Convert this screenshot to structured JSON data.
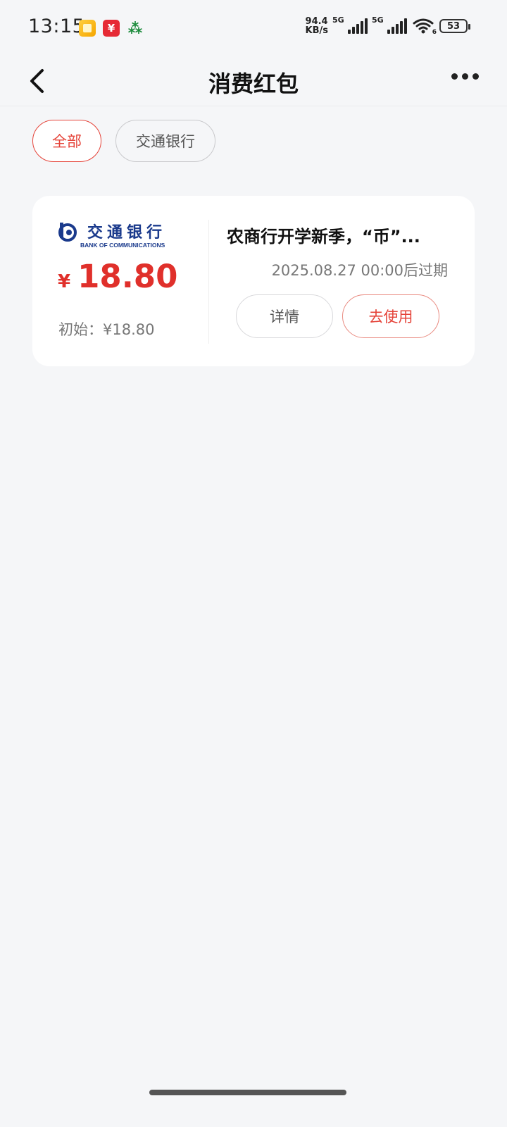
{
  "status_bar": {
    "time": "13:15",
    "net_speed_value": "94.4",
    "net_speed_unit": "KB/s",
    "network_1": "5G",
    "network_2": "5G",
    "wifi_sub": "6",
    "battery": "53"
  },
  "nav": {
    "title": "消费红包"
  },
  "filters": [
    {
      "label": "全部",
      "active": true
    },
    {
      "label": "交通银行",
      "active": false
    }
  ],
  "card": {
    "bank_name_cn": "交通银行",
    "bank_name_en": "BANK OF COMMUNICATIONS",
    "currency": "¥",
    "amount": "18.80",
    "initial_label": "初始：¥18.80",
    "promo_title": "农商行开学新季，“币”...",
    "expiry": "2025.08.27 00:00后过期",
    "detail_label": "详情",
    "use_label": "去使用"
  },
  "colors": {
    "accent": "#e5443a",
    "bank_blue": "#1a3a8c"
  }
}
